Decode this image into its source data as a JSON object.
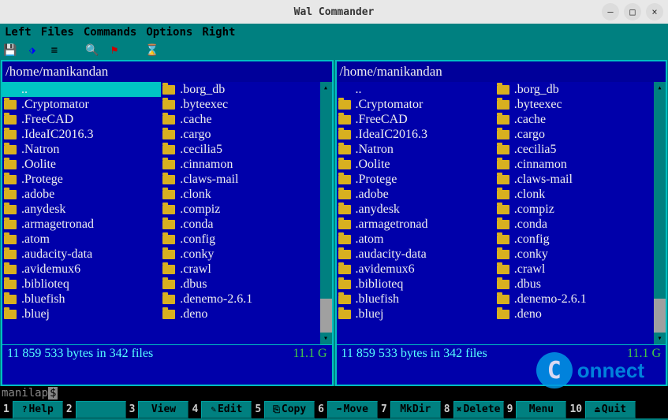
{
  "window": {
    "title": "Wal Commander"
  },
  "menubar": [
    "Left",
    "Files",
    "Commands",
    "Options",
    "Right"
  ],
  "toolbar_icons": [
    "save-icon",
    "split-icon",
    "menu-icon",
    "search-icon",
    "flag-icon",
    "hourglass-icon"
  ],
  "panel_left": {
    "path": "/home/manikandan",
    "col1": [
      "..",
      ".Cryptomator",
      ".FreeCAD",
      ".IdeaIC2016.3",
      ".Natron",
      ".Oolite",
      ".Protege",
      ".adobe",
      ".anydesk",
      ".armagetronad",
      ".atom",
      ".audacity-data",
      ".avidemux6",
      ".biblioteq",
      ".bluefish",
      ".bluej"
    ],
    "col2": [
      ".borg_db",
      ".byteexec",
      ".cache",
      ".cargo",
      ".cecilia5",
      ".cinnamon",
      ".claws-mail",
      ".clonk",
      ".compiz",
      ".conda",
      ".config",
      ".conky",
      ".crawl",
      ".dbus",
      ".denemo-2.6.1",
      ".deno"
    ],
    "status": "11 859 533 bytes in 342 files",
    "free": "11.1 G"
  },
  "panel_right": {
    "path": "/home/manikandan",
    "col1": [
      "..",
      ".Cryptomator",
      ".FreeCAD",
      ".IdeaIC2016.3",
      ".Natron",
      ".Oolite",
      ".Protege",
      ".adobe",
      ".anydesk",
      ".armagetronad",
      ".atom",
      ".audacity-data",
      ".avidemux6",
      ".biblioteq",
      ".bluefish",
      ".bluej"
    ],
    "col2": [
      ".borg_db",
      ".byteexec",
      ".cache",
      ".cargo",
      ".cecilia5",
      ".cinnamon",
      ".claws-mail",
      ".clonk",
      ".compiz",
      ".conda",
      ".config",
      ".conky",
      ".crawl",
      ".dbus",
      ".denemo-2.6.1",
      ".deno"
    ],
    "status": "11 859 533 bytes in 342 files",
    "free": "11.1 G"
  },
  "cmdline": {
    "prompt": "manilap",
    "dollar": "$"
  },
  "fkeys": [
    {
      "n": "1",
      "label": "Help",
      "icon": "?"
    },
    {
      "n": "2",
      "label": "",
      "icon": ""
    },
    {
      "n": "3",
      "label": "View",
      "icon": ""
    },
    {
      "n": "4",
      "label": "Edit",
      "icon": "✎"
    },
    {
      "n": "5",
      "label": "Copy",
      "icon": "⎘"
    },
    {
      "n": "6",
      "label": "Move",
      "icon": "➦"
    },
    {
      "n": "7",
      "label": "MkDir",
      "icon": ""
    },
    {
      "n": "8",
      "label": "Delete",
      "icon": "✖"
    },
    {
      "n": "9",
      "label": "Menu",
      "icon": ""
    },
    {
      "n": "10",
      "label": "Quit",
      "icon": "⏏"
    }
  ],
  "watermark": {
    "c": "C",
    "text": "onnect"
  }
}
